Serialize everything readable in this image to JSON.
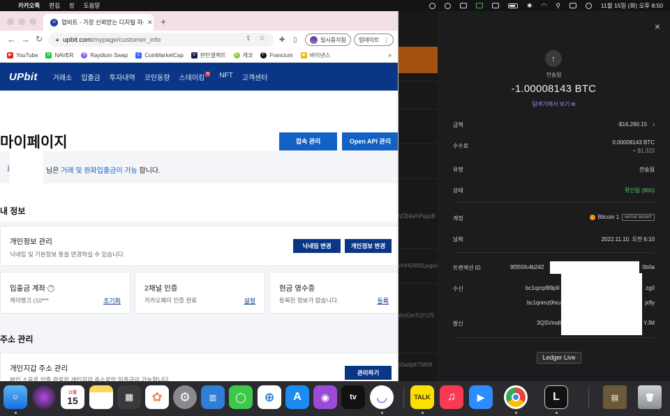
{
  "menubar": {
    "apple": "",
    "app_name": "카카오톡",
    "menus": [
      "편집",
      "창",
      "도움말"
    ],
    "clock": "11월 15일 (화) 오후 8:50"
  },
  "browser": {
    "tab_title": "업비트 - 가장 신뢰받는 디지털 자산",
    "tab_favicon": "U",
    "url_host": "upbit.com",
    "url_path": "/mypage/customer_info",
    "profile_label": "일시중지됨",
    "update_label": "업데이트",
    "bookmarks": [
      {
        "label": "YouTube",
        "color": "#e62117",
        "glyph": "▶"
      },
      {
        "label": "NAVER",
        "color": "#1fc83e",
        "glyph": "N"
      },
      {
        "label": "Raydium Swap",
        "color": "#8b5cf6",
        "glyph": "R"
      },
      {
        "label": "CoinMarketCap",
        "color": "#3861fb",
        "glyph": "C"
      },
      {
        "label": "판탄셀렉트",
        "color": "#1a1a4a",
        "glyph": "V"
      },
      {
        "label": "게코",
        "color": "#8dc63f",
        "glyph": "G"
      },
      {
        "label": "Francium",
        "color": "#111111",
        "glyph": "F"
      },
      {
        "label": "바이낸스",
        "color": "#f0b90b",
        "glyph": "◆"
      }
    ],
    "bookmarks_more": "»"
  },
  "upbit": {
    "logo": "UPbit",
    "nav": [
      "거래소",
      "입출금",
      "투자내역",
      "코인동향",
      "스테이킹",
      "NFT",
      "고객센터"
    ],
    "nav_badge": "N",
    "page_title": "마이페이지",
    "btn_access": "접속 관리",
    "btn_api": "Open API 관리",
    "notice_initial": "j",
    "notice_pre": "님은 ",
    "notice_link": "거래 및 원화입출금이 가능",
    "notice_post": " 합니다.",
    "my_info_heading": "내 정보",
    "personal_title": "개인정보 관리",
    "personal_desc": "닉네임 및 기본정보 등을 변경하실 수 있습니다.",
    "btn_nickname": "닉네임 변경",
    "btn_personal": "개인정보 변경",
    "account_title": "입출금 계좌",
    "account_help": "?",
    "account_desc": "케이뱅크 (10***",
    "account_action": "초기화",
    "twofa_title": "2채널 인증",
    "twofa_desc": "카카오페이 인증 완료",
    "twofa_action": "설정",
    "receipt_title": "현금 영수증",
    "receipt_desc": "등록된 정보가 없습니다.",
    "receipt_action": "등록",
    "address_heading": "주소 관리",
    "wallet_title": "개인지갑 주소 관리",
    "wallet_desc": "본인 소유로 인증 완료된 개인지갑 주소로만 입출금이 가능합니다.",
    "btn_wallet": "관리하기"
  },
  "bg_window": {
    "fragments": [
      "nCEikehPqqsB",
      "VHHDW81jxgoA",
      "shsGwTcjYc25",
      "c0azlplt75808"
    ]
  },
  "ledger": {
    "close": "×",
    "arrow": "↑",
    "status_top": "전송됨",
    "amount": "-1.00008143 BTC",
    "explorer_link": "탐색기에서 보기",
    "rows": {
      "amount_label": "금액",
      "amount_value": "-$16,260.15",
      "fee_label": "수수료",
      "fee_value": "0.00008143 BTC",
      "fee_usd": "≈ $1.323",
      "type_label": "유형",
      "type_value": "전송됨",
      "state_label": "상태",
      "state_value": "확인됨 (800)",
      "account_label": "계정",
      "account_value": "Bitcoin 1",
      "account_badge": "NATIVE SEGWIT",
      "date_label": "날짜",
      "date_value": "2022.11.10. 오전 6:10",
      "txid_label": "트랜잭션 ID",
      "txid_value": "9f355fc4b242",
      "txid_end": "0b0a",
      "recv_label": "수신",
      "recv_value1": "bc1qzrpf99p9",
      "recv_end1": "zg0",
      "recv_value2": "bc1qnmz0hru",
      "recv_end2": "jxfly",
      "send_label": "발신",
      "send_value": "3QSVmdt",
      "send_end": "YJM"
    },
    "tooltip": "Ledger Live",
    "colors": {
      "accent": "#9c8cf6",
      "confirmed": "#5ec56c",
      "bitcoin": "#f7931a"
    }
  },
  "dock": {
    "calendar_month": "11월",
    "calendar_day": "15",
    "appletv": "tv",
    "kakao": "TALK"
  }
}
